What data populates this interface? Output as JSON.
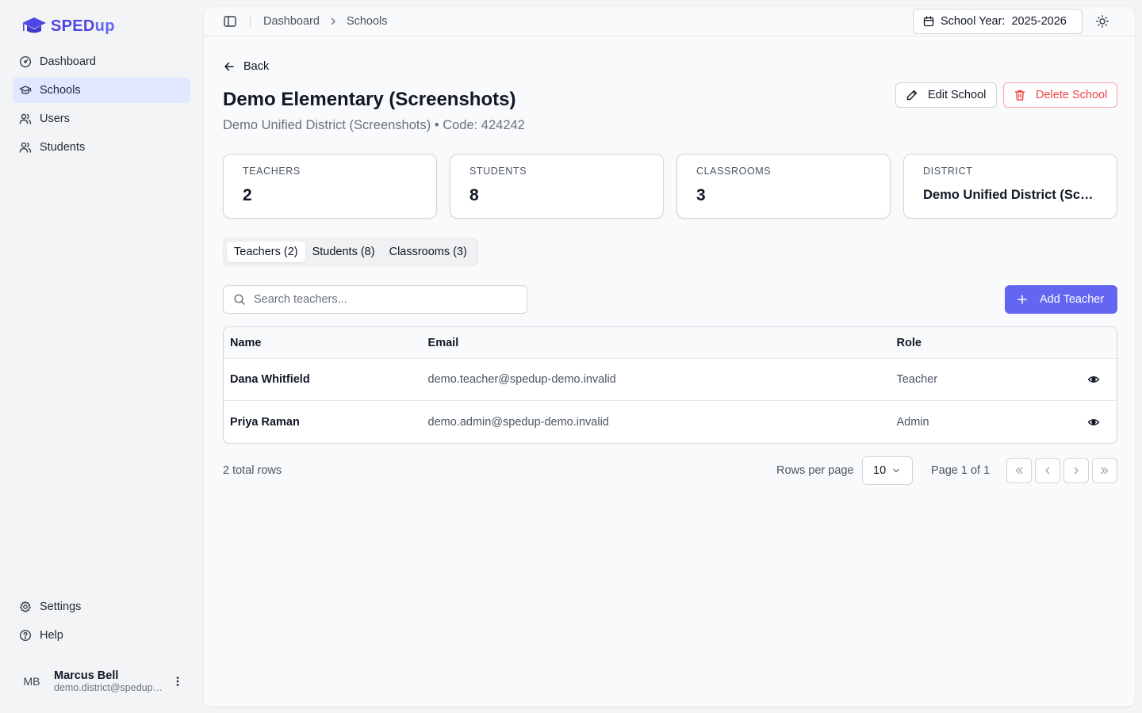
{
  "brand": {
    "name_a": "SPED",
    "name_b": "up"
  },
  "sidebar": {
    "items": [
      {
        "label": "Dashboard",
        "icon": "gauge-icon"
      },
      {
        "label": "Schools",
        "icon": "graduation-cap-icon"
      },
      {
        "label": "Users",
        "icon": "users-icon"
      },
      {
        "label": "Students",
        "icon": "users-icon"
      }
    ],
    "bottom": [
      {
        "label": "Settings",
        "icon": "gear-icon"
      },
      {
        "label": "Help",
        "icon": "help-circle-icon"
      }
    ],
    "user": {
      "initials": "MB",
      "name": "Marcus Bell",
      "email": "demo.district@spedup-demo.invalid"
    }
  },
  "topbar": {
    "breadcrumb": [
      "Dashboard",
      "Schools"
    ],
    "school_year": "School Year:  2025-2026"
  },
  "page": {
    "back_label": "Back",
    "title": "Demo Elementary (Screenshots)",
    "subtitle": "Demo Unified District (Screenshots) • Code: 424242",
    "edit_label": "Edit School",
    "delete_label": "Delete School"
  },
  "stats": [
    {
      "label": "TEACHERS",
      "value": "2"
    },
    {
      "label": "STUDENTS",
      "value": "8"
    },
    {
      "label": "CLASSROOMS",
      "value": "3"
    },
    {
      "label": "DISTRICT",
      "value": "Demo Unified District (Screenshots)"
    }
  ],
  "tabs": [
    "Teachers (2)",
    "Students (8)",
    "Classrooms (3)"
  ],
  "search": {
    "placeholder": "Search teachers..."
  },
  "add_label": "Add Teacher",
  "table": {
    "headers": [
      "Name",
      "Email",
      "Role"
    ],
    "rows": [
      {
        "name": "Dana Whitfield",
        "email": "demo.teacher@spedup-demo.invalid",
        "role": "Teacher"
      },
      {
        "name": "Priya Raman",
        "email": "demo.admin@spedup-demo.invalid",
        "role": "Admin"
      }
    ]
  },
  "pagination": {
    "total": "2 total rows",
    "rows_per_page_label": "Rows per page",
    "rows_per_page": "10",
    "page_label": "Page 1 of 1"
  },
  "colors": {
    "accent": "#6366f1",
    "danger": "#ef4444",
    "active_nav": "#e0e7ff"
  }
}
